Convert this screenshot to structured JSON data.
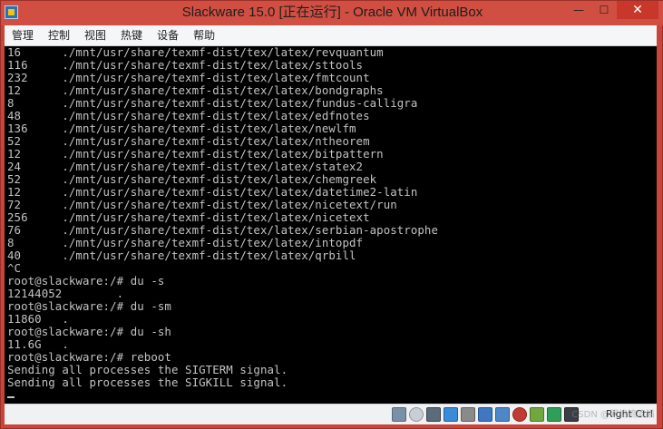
{
  "window": {
    "title": "Slackware 15.0 [正在运行] - Oracle VM VirtualBox",
    "icon": "virtualbox-app-icon",
    "controls": {
      "minimize": "—",
      "maximize": "☐",
      "close": "✕"
    }
  },
  "menubar": {
    "items": [
      "管理",
      "控制",
      "视图",
      "热键",
      "设备",
      "帮助"
    ]
  },
  "terminal": {
    "lines": [
      "16      ./mnt/usr/share/texmf-dist/tex/latex/revquantum",
      "116     ./mnt/usr/share/texmf-dist/tex/latex/sttools",
      "232     ./mnt/usr/share/texmf-dist/tex/latex/fmtcount",
      "12      ./mnt/usr/share/texmf-dist/tex/latex/bondgraphs",
      "8       ./mnt/usr/share/texmf-dist/tex/latex/fundus-calligra",
      "48      ./mnt/usr/share/texmf-dist/tex/latex/edfnotes",
      "136     ./mnt/usr/share/texmf-dist/tex/latex/newlfm",
      "52      ./mnt/usr/share/texmf-dist/tex/latex/ntheorem",
      "12      ./mnt/usr/share/texmf-dist/tex/latex/bitpattern",
      "24      ./mnt/usr/share/texmf-dist/tex/latex/statex2",
      "52      ./mnt/usr/share/texmf-dist/tex/latex/chemgreek",
      "12      ./mnt/usr/share/texmf-dist/tex/latex/datetime2-latin",
      "72      ./mnt/usr/share/texmf-dist/tex/latex/nicetext/run",
      "256     ./mnt/usr/share/texmf-dist/tex/latex/nicetext",
      "76      ./mnt/usr/share/texmf-dist/tex/latex/serbian-apostrophe",
      "8       ./mnt/usr/share/texmf-dist/tex/latex/intopdf",
      "40      ./mnt/usr/share/texmf-dist/tex/latex/qrbill",
      "^C",
      "root@slackware:/# du -s",
      "12144052        .",
      "root@slackware:/# du -sm",
      "11860   .",
      "root@slackware:/# du -sh",
      "11.6G   .",
      "root@slackware:/# reboot",
      "Sending all processes the SIGTERM signal.",
      "Sending all processes the SIGKILL signal."
    ]
  },
  "statusbar": {
    "icons": [
      "hard-disk-icon",
      "optical-drive-icon",
      "audio-icon",
      "network-icon",
      "usb-icon",
      "shared-folder-icon",
      "display-icon",
      "video-capture-icon",
      "cpu-icon",
      "mouse-integration-icon",
      "keyboard-icon"
    ],
    "host_key": "Right Ctrl"
  },
  "watermark": {
    "text": "CSDN @网络流浪猫"
  },
  "colors": {
    "titlebar": "#d14f42",
    "close_button": "#c7382b",
    "terminal_bg": "#000000",
    "terminal_fg": "#c3c3c3",
    "menubar": "#f5f6f7",
    "statusbar": "#f0f1f3"
  }
}
